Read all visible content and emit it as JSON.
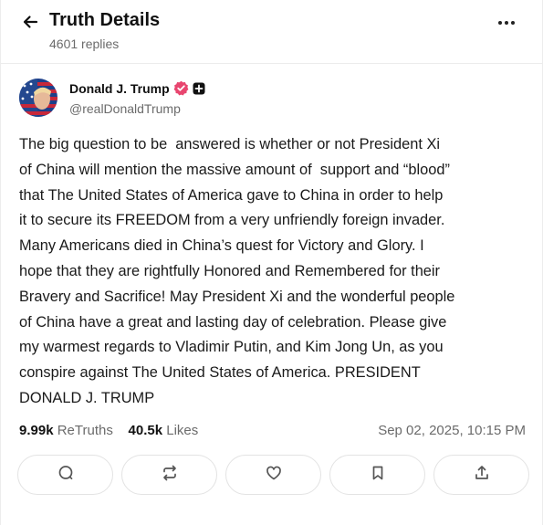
{
  "header": {
    "title": "Truth Details",
    "replies": "4601 replies",
    "back_icon": "arrow-left-icon",
    "more_icon": "more-horizontal-icon"
  },
  "author": {
    "name": "Donald J. Trump",
    "handle": "@realDonaldTrump",
    "verified_color": "#e8456f"
  },
  "post": {
    "lines": [
      "The big question to be  answered is whether or not President Xi",
      "of China will mention the massive amount of  support and “blood”",
      "that The United States of America gave to China in order to help",
      "it to secure its FREEDOM from a very unfriendly foreign invader.",
      "Many Americans died in China’s quest for Victory and Glory. I",
      "hope that they are rightfully Honored and Remembered for their",
      "Bravery and Sacrifice! May President Xi and the wonderful people",
      "of China have a great and lasting day of celebration. Please give",
      "my warmest regards to Vladimir Putin, and Kim Jong Un, as you",
      "conspire against The United States of America. PRESIDENT",
      "DONALD J. TRUMP"
    ]
  },
  "stats": {
    "retruths_count": "9.99k",
    "retruths_label": "ReTruths",
    "likes_count": "40.5k",
    "likes_label": "Likes",
    "timestamp": "Sep 02, 2025, 10:15 PM"
  },
  "actions": [
    "reply-icon",
    "retruth-icon",
    "like-icon",
    "bookmark-icon",
    "share-icon"
  ]
}
